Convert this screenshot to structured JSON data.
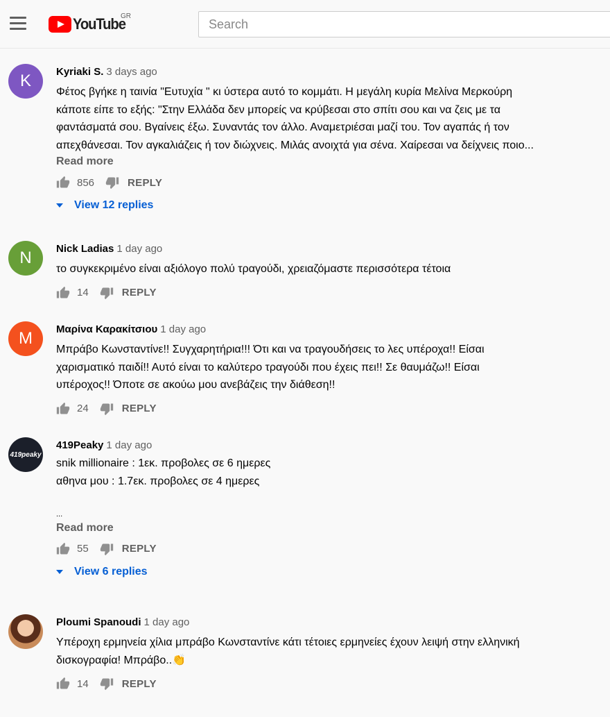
{
  "header": {
    "logo_text": "YouTube",
    "country_code": "GR",
    "search_placeholder": "Search"
  },
  "comments": [
    {
      "author": "Kyriaki S.",
      "time": "3 days ago",
      "avatar_letter": "K",
      "avatar_color": "#7e57c2",
      "lines": [
        "Φέτος βγήκε η ταινία \"Ευτυχία \" κι ύστερα αυτό το κομμάτι. Η μεγάλη κυρία Μελίνα Μερκούρη",
        "κάποτε είπε το εξής: \"Στην Ελλάδα δεν μπορείς να κρύβεσαι στο σπίτι σου και να ζεις με τα",
        "φαντάσματά σου. Βγαίνεις έξω. Συναντάς τον άλλο. Αναμετριέσαι μαζί του. Τον αγαπάς ή τον",
        "απεχθάνεσαι. Τον αγκαλιάζεις ή τον διώχνεις. Μιλάς ανοιχτά για σένα. Χαίρεσαι να δείχνεις ποιο..."
      ],
      "read_more": "Read more",
      "likes": "856",
      "reply": "REPLY",
      "view_replies": "View 12 replies"
    },
    {
      "author": "Nick Ladias",
      "time": "1 day ago",
      "avatar_letter": "N",
      "avatar_color": "#689f38",
      "lines": [
        "το συγκεκριμένο είναι αξιόλογο πολύ τραγούδι, χρειαζόμαστε περισσότερα τέτοια"
      ],
      "likes": "14",
      "reply": "REPLY"
    },
    {
      "author": "Μαρίνα Καρακίτσιου",
      "time": "1 day ago",
      "avatar_letter": "M",
      "avatar_color": "#f4511e",
      "lines": [
        "Μπράβο Κωνσταντίνε!! Συγχαρητήρια!!! Ότι και να τραγουδήσεις το λες υπέροχα!! Είσαι",
        "χαρισματικό παιδί!! Αυτό είναι το καλύτερο τραγούδι που έχεις πει!! Σε θαυμάζω!! Είσαι",
        "υπέροχος!! Όποτε σε ακούω μου ανεβάζεις την διάθεση!!"
      ],
      "likes": "24",
      "reply": "REPLY"
    },
    {
      "author": "419Peaky",
      "time": "1 day ago",
      "avatar_letter": "419peaky",
      "avatar_color": "#1b1f2a",
      "lines": [
        "snik millionaire : 1εκ. προβολες σε 6 ημερες",
        "αθηνα μου : 1.7εκ. προβολες σε 4 ημερες",
        "",
        "..."
      ],
      "read_more": "Read more",
      "likes": "55",
      "reply": "REPLY",
      "view_replies": "View 6 replies"
    },
    {
      "author": "Ploumi Spanoudi",
      "time": "1 day ago",
      "avatar_color": "#a0522d",
      "lines": [
        "Υπέροχη ερμηνεία χίλια μπράβο Κωνσταντίνε κάτι τέτοιες ερμηνείες έχουν λειψή στην ελληνική",
        "δισκογραφία! Μπράβο..👏"
      ],
      "likes": "14",
      "reply": "REPLY"
    }
  ]
}
